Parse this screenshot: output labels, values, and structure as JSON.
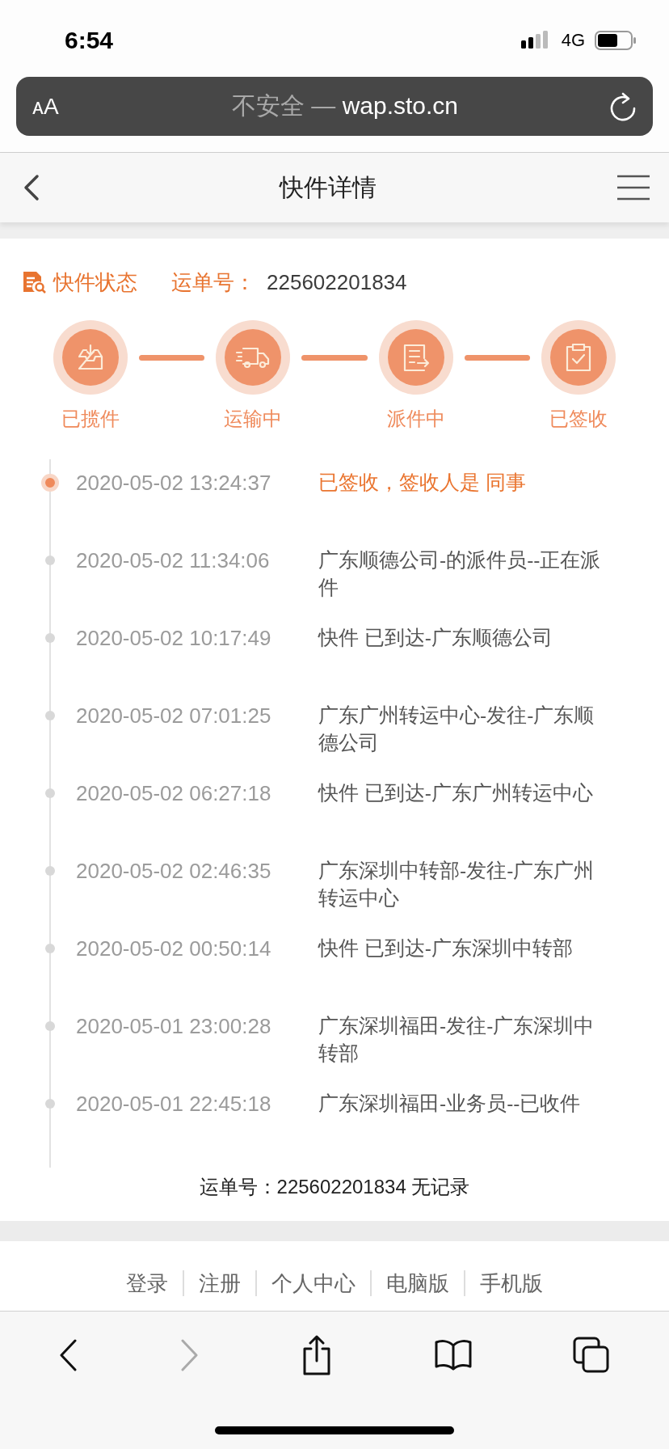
{
  "status_bar": {
    "time": "6:54",
    "network": "4G"
  },
  "address_bar": {
    "text_size_button": "ᴀA",
    "security_label": "不安全 —",
    "domain": "wap.sto.cn"
  },
  "header": {
    "title": "快件详情"
  },
  "tracking": {
    "section_title": "快件状态",
    "number_label": "运单号：",
    "number": "225602201834"
  },
  "steps": [
    {
      "label": "已揽件",
      "kind": "pickup"
    },
    {
      "label": "运输中",
      "kind": "transit"
    },
    {
      "label": "派件中",
      "kind": "delivering"
    },
    {
      "label": "已签收",
      "kind": "signed"
    }
  ],
  "events": [
    {
      "time": "2020-05-02 13:24:37",
      "text": "已签收，签收人是 同事",
      "latest": true
    },
    {
      "time": "2020-05-02 11:34:06",
      "text": "广东顺德公司-的派件员--正在派件",
      "latest": false
    },
    {
      "time": "2020-05-02 10:17:49",
      "text": "快件 已到达-广东顺德公司",
      "latest": false
    },
    {
      "time": "2020-05-02 07:01:25",
      "text": "广东广州转运中心-发往-广东顺德公司",
      "latest": false
    },
    {
      "time": "2020-05-02 06:27:18",
      "text": "快件 已到达-广东广州转运中心",
      "latest": false
    },
    {
      "time": "2020-05-02 02:46:35",
      "text": "广东深圳中转部-发往-广东广州转运中心",
      "latest": false
    },
    {
      "time": "2020-05-02 00:50:14",
      "text": "快件 已到达-广东深圳中转部",
      "latest": false
    },
    {
      "time": "2020-05-01 23:00:28",
      "text": "广东深圳福田-发往-广东深圳中转部",
      "latest": false
    },
    {
      "time": "2020-05-01 22:45:18",
      "text": "广东深圳福田-业务员--已收件",
      "latest": false
    }
  ],
  "no_record_note": "运单号：225602201834 无记录",
  "footer_links": [
    "登录",
    "注册",
    "个人中心",
    "电脑版",
    "手机版"
  ],
  "browser_toolbar": {
    "back_disabled": false,
    "forward_disabled": true
  }
}
